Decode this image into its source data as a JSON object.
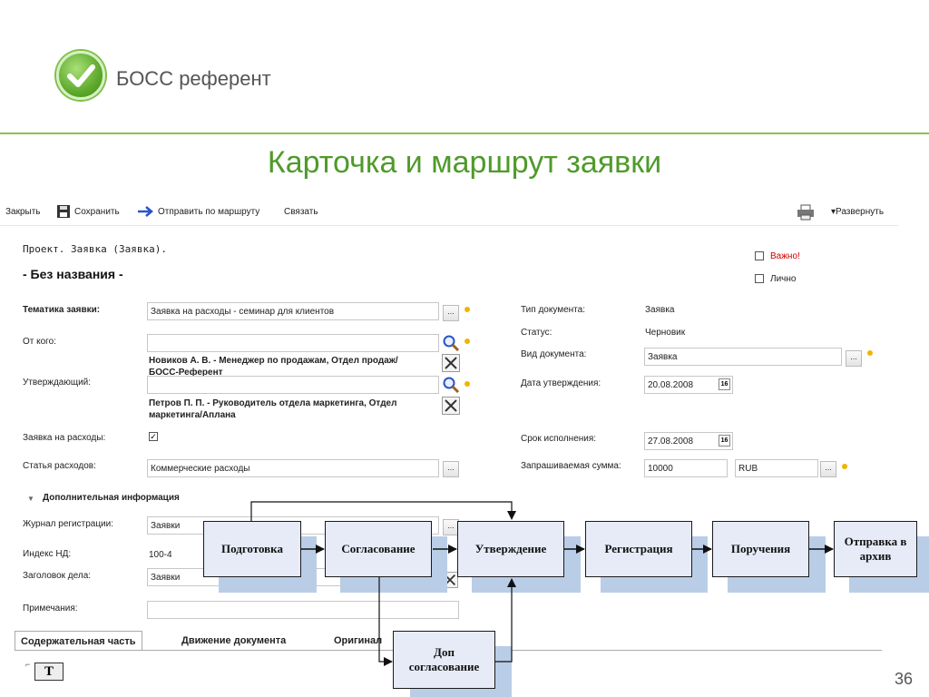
{
  "header": {
    "logo_text": "БОСС референт",
    "slide_title": "Карточка и маршрут заявки",
    "page_number": "36"
  },
  "toolbar": {
    "close": "Закрыть",
    "save": "Сохранить",
    "send": "Отправить по маршруту",
    "link": "Связать",
    "expand": "▾Развернуть"
  },
  "form": {
    "doc_project": "Проект. Заявка (Заявка).",
    "doc_name": "- Без названия -",
    "important": "Важно!",
    "personal": "Лично",
    "topic_label": "Тематика заявки:",
    "topic_value": "Заявка на расходы - семинар для клиентов",
    "from_label": "От кого:",
    "from_person": "Новиков А. В. - Менеджер по продажам, Отдел продаж/БОСС-Референт",
    "approver_label": "Утверждающий:",
    "approver_person": "Петров П. П. - Руководитель отдела маркетинга, Отдел маркетинга/Аплана",
    "expense_request_label": "Заявка на расходы:",
    "expense_item_label": "Статья расходов:",
    "expense_item_value": "Коммерческие расходы",
    "doc_type_label": "Тип документа:",
    "doc_type_value": "Заявка",
    "status_label": "Статус:",
    "status_value": "Черновик",
    "doc_kind_label": "Вид документа:",
    "doc_kind_value": "Заявка",
    "approval_date_label": "Дата утверждения:",
    "approval_date_value": "20.08.2008",
    "deadline_label": "Срок исполнения:",
    "deadline_value": "27.08.2008",
    "amount_label": "Запрашиваемая сумма:",
    "amount_value": "10000",
    "currency_value": "RUB",
    "calendar_icon": "16",
    "dots_label": "...",
    "extra_info": "Дополнительная информация",
    "journal_label": "Журнал регистрации:",
    "journal_value": "Заявки",
    "index_label": "Индекс НД:",
    "index_value": "100-4",
    "case_title_label": "Заголовок дела:",
    "case_title_value": "Заявки",
    "notes_label": "Примечания:"
  },
  "tabs": [
    "Содержательная часть",
    "Движение документа",
    "Оригинал"
  ],
  "text_tool_label": "T",
  "diagram": {
    "steps": [
      "Подготовка",
      "Согласование",
      "Утверждение",
      "Регистрация",
      "Поручения",
      "Отправка в архив"
    ],
    "extra_step": "Доп согласование"
  },
  "colors": {
    "accent_green": "#4f9a2a",
    "box_fill": "#e6ebf7",
    "box_shadow": "#b9cde7",
    "required_dot": "#f2b400"
  }
}
